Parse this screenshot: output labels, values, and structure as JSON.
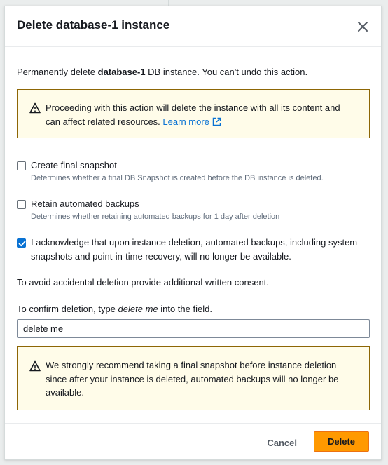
{
  "modal": {
    "title": "Delete database-1 instance",
    "intro_prefix": "Permanently delete ",
    "instance_name": "database-1",
    "intro_suffix": " DB instance. You can't undo this action."
  },
  "alert_top": {
    "text": "Proceeding with this action will delete the instance with all its content and can affect related resources.",
    "link_label": "Learn more"
  },
  "options": [
    {
      "label": "Create final snapshot",
      "description": "Determines whether a final DB Snapshot is created before the DB instance is deleted.",
      "checked": false
    },
    {
      "label": "Retain automated backups",
      "description": "Determines whether retaining automated backups for 1 day after deletion",
      "checked": false
    },
    {
      "label": "I acknowledge that upon instance deletion, automated backups, including system snapshots and point-in-time recovery, will no longer be available.",
      "checked": true
    }
  ],
  "consent": {
    "text": "To avoid accidental deletion provide additional written consent.",
    "confirm_prefix": "To confirm deletion, type ",
    "confirm_phrase": "delete me",
    "confirm_suffix": " into the field.",
    "input_value": "delete me"
  },
  "alert_bottom": {
    "text": "We strongly recommend taking a final snapshot before instance deletion since after your instance is deleted, automated backups will no longer be available."
  },
  "footer": {
    "cancel_label": "Cancel",
    "delete_label": "Delete"
  },
  "colors": {
    "accent": "#0972d3",
    "warning_border": "#8d6605",
    "warning_bg": "#fffce9",
    "primary_button": "#ff9900"
  },
  "icons": {
    "close": "close-icon",
    "warning": "warning-icon",
    "external": "external-link-icon",
    "check": "check-icon"
  }
}
